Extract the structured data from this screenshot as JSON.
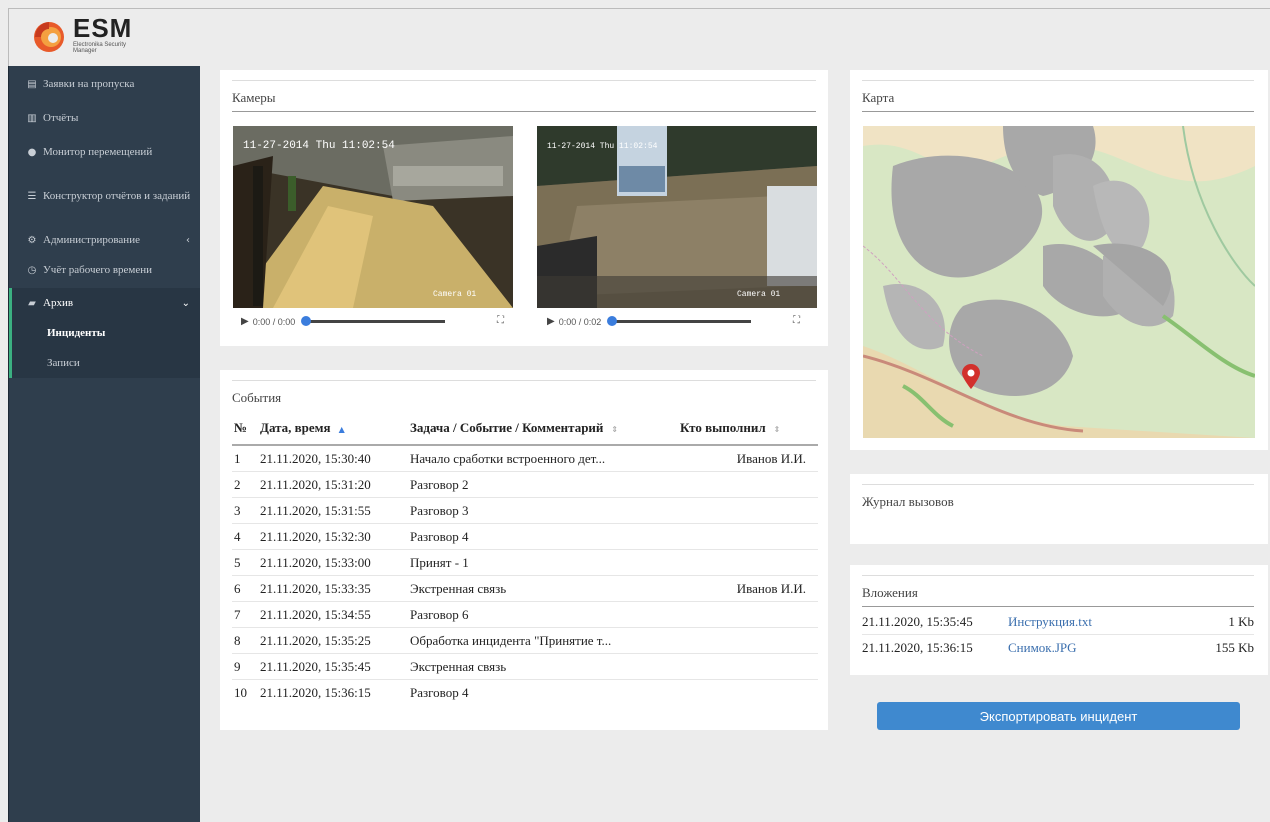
{
  "brand": {
    "name": "ESM",
    "subtitle": "Electronika Security Manager"
  },
  "sidebar": {
    "items": [
      {
        "label": "Заявки на пропуска",
        "icon": "id-card-icon"
      },
      {
        "label": "Отчёты",
        "icon": "bar-chart-icon"
      },
      {
        "label": "Монитор перемещений",
        "icon": "map-marker-icon"
      },
      {
        "label": "Конструктор отчётов и заданий",
        "icon": "sliders-icon"
      },
      {
        "label": "Администрирование",
        "icon": "gears-icon"
      },
      {
        "label": "Учёт рабочего времени",
        "icon": "clock-icon"
      },
      {
        "label": "Архив",
        "icon": "folder-open-icon"
      }
    ],
    "archive_children": [
      {
        "label": "Инциденты"
      },
      {
        "label": "Записи"
      }
    ]
  },
  "cameras": {
    "title": "Камеры",
    "videos": [
      {
        "time": "0:00 / 0:00",
        "overlay_time": "11-27-2014 Thu 11:02:54",
        "caption": "Camera 01",
        "progress": 0
      },
      {
        "time": "0:00 / 0:02",
        "overlay_time": "11-27-2014 Thu 11:02:54",
        "caption": "Camera 01",
        "progress": 0
      }
    ]
  },
  "events": {
    "title": "События",
    "columns": [
      "№",
      "Дата, время",
      "Задача / Событие / Комментарий",
      "Кто выполнил"
    ],
    "rows": [
      {
        "n": "1",
        "date": "21.11.2020,  15:30:40",
        "task": "Начало сработки встроенного дет...",
        "who": "Иванов И.И."
      },
      {
        "n": "2",
        "date": "21.11.2020,  15:31:20",
        "task": "Разговор 2",
        "who": ""
      },
      {
        "n": "3",
        "date": "21.11.2020,  15:31:55",
        "task": "Разговор 3",
        "who": ""
      },
      {
        "n": "4",
        "date": "21.11.2020,  15:32:30",
        "task": "Разговор 4",
        "who": ""
      },
      {
        "n": "5",
        "date": "21.11.2020,  15:33:00",
        "task": "Принят - 1",
        "who": ""
      },
      {
        "n": "6",
        "date": "21.11.2020,  15:33:35",
        "task": "Экстренная связь",
        "who": "Иванов И.И."
      },
      {
        "n": "7",
        "date": "21.11.2020,  15:34:55",
        "task": "Разговор 6",
        "who": ""
      },
      {
        "n": "8",
        "date": "21.11.2020,  15:35:25",
        "task": "Обработка инцидента \"Принятие т...",
        "who": ""
      },
      {
        "n": "9",
        "date": "21.11.2020,  15:35:45",
        "task": "Экстренная связь",
        "who": ""
      },
      {
        "n": "10",
        "date": "21.11.2020,  15:36:15",
        "task": "Разговор 4",
        "who": ""
      }
    ]
  },
  "map": {
    "title": "Карта"
  },
  "calls": {
    "title": "Журнал вызовов"
  },
  "attachments": {
    "title": "Вложения",
    "rows": [
      {
        "date": "21.11.2020,  15:35:45",
        "name": "Инструкция.txt",
        "size": "1 Kb"
      },
      {
        "date": "21.11.2020,  15:36:15",
        "name": "Снимок.JPG",
        "size": "155 Kb"
      }
    ]
  },
  "export_button": "Экспортировать инцидент",
  "colors": {
    "sidebar": "#2f3e4d",
    "accent": "#3bb081",
    "link": "#3b6fae",
    "button": "#3f89cf"
  }
}
